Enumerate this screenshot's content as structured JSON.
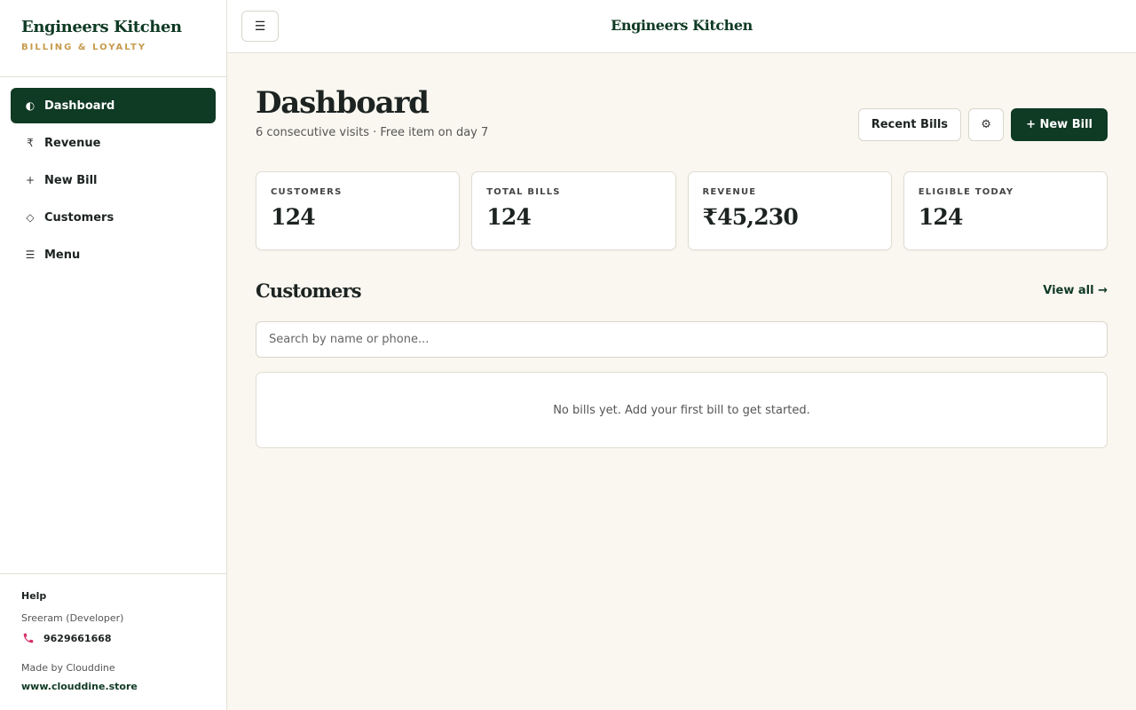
{
  "sidebar": {
    "brand_title": "Engineers Kitchen",
    "brand_subtitle": "BILLING & LOYALTY",
    "items": [
      {
        "label": "Dashboard",
        "icon": "◐",
        "active": true
      },
      {
        "label": "Revenue",
        "icon": "₹"
      },
      {
        "label": "New Bill",
        "icon": "+"
      },
      {
        "label": "Customers",
        "icon": "◇"
      },
      {
        "label": "Menu",
        "icon": "☰"
      }
    ],
    "footer": {
      "help_title": "Help",
      "developer": "Sreeram (Developer)",
      "phone": "9629661668",
      "made_by": "Made by Clouddine",
      "website": "www.clouddine.store"
    }
  },
  "topbar": {
    "menu_icon": "☰",
    "title": "Engineers Kitchen"
  },
  "main": {
    "title": "Dashboard",
    "subtitle": "6 consecutive visits · Free item on day 7",
    "actions": {
      "recent_bills": "Recent Bills",
      "settings_icon": "⚙",
      "new_bill": "+ New Bill"
    },
    "stats": [
      {
        "label": "CUSTOMERS",
        "value": "124"
      },
      {
        "label": "TOTAL BILLS",
        "value": "124"
      },
      {
        "label": "REVENUE",
        "value": "₹45,230"
      },
      {
        "label": "ELIGIBLE TODAY",
        "value": "124"
      }
    ],
    "customers_section": {
      "title": "Customers",
      "view_all": "View all →",
      "search_placeholder": "Search by name or phone...",
      "empty_message": "No bills yet. Add your first bill to get started."
    }
  },
  "colors": {
    "brand_green": "#0f3a24",
    "accent_gold": "#c69a4c",
    "background": "#faf7f0",
    "phone_pink": "#d6336c"
  }
}
